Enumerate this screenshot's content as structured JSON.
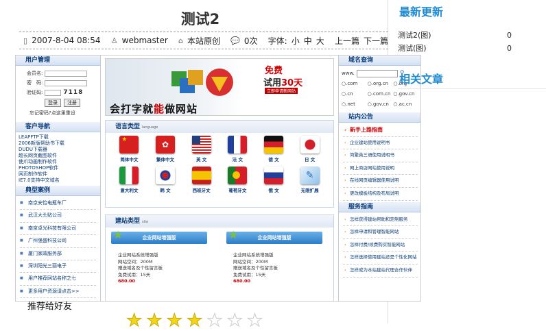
{
  "article": {
    "title": "测试2",
    "date": "2007-8-04 08:54",
    "author": "webmaster",
    "source": "本站原创",
    "views": "0次",
    "font_label": "字体:",
    "font_small": "小",
    "font_medium": "中",
    "font_large": "大",
    "prev": "上一篇",
    "next": "下一篇"
  },
  "screenshot": {
    "login": {
      "header": "用户管理",
      "user_label": "会员名:",
      "pass_label": "密　码:",
      "code_label": "验证码:",
      "code_value": "7118",
      "login_btn": "登录",
      "register_btn": "注册",
      "forgot": "忘记密码?点这里重设"
    },
    "client_nav": {
      "header": "客户导航",
      "items": [
        "LEAPFTP下载",
        "2006新版帮助书下载",
        "DUDU下载器",
        "超长网页截图软件",
        "使爪动画制作软件",
        "PHOTOSHOP软件",
        "网页制作软件",
        "IE7.0支持中文域名"
      ]
    },
    "cases": {
      "header": "典型案例",
      "items": [
        "南京安怡电瓶车厂",
        "武汉大头贴公司",
        "南京卓光科技有限公司",
        "广州强盛科技公司",
        "厦门家政服务部",
        "深圳阳光三丽电子",
        "用户推荐网站名称之七",
        "更多用户资源请点击>>"
      ]
    },
    "banner": {
      "line1_a": "会打字就",
      "line1_b": "能",
      "line1_c": "做网站",
      "free": "免费",
      "trial_a": "试用",
      "trial_b": "30天",
      "apply": "立即申请新网站"
    },
    "languages": {
      "header": "语言类型",
      "sub": "language",
      "items": [
        "简体中文",
        "繁体中文",
        "英 文",
        "法 文",
        "德 文",
        "日 文",
        "意大利文",
        "韩 文",
        "西班牙文",
        "葡萄牙文",
        "俄 文",
        "无限扩展"
      ]
    },
    "site_types": {
      "header": "建站类型",
      "sub": "site",
      "cards": [
        {
          "banner": "企业网站增强版",
          "l1": "企业网站系统增强版",
          "l2": "网站空间：200M",
          "l3": "赠送域名及个性留言板",
          "l4": "免费试用：15天",
          "price": "680.00"
        },
        {
          "banner": "企业网站增强版",
          "l1": "企业网站系统增强版",
          "l2": "网站空间：200M",
          "l3": "赠送域名及个性留言板",
          "l4": "免费试用：15天",
          "price": "680.00"
        }
      ]
    },
    "domain": {
      "header": "域名查询",
      "www": "www.",
      "exts": [
        ".com",
        ".org.cn",
        ".org",
        ".cn",
        ".com.cn",
        ".gov.cn",
        ".net",
        ".gov.cn",
        ".ac.cn"
      ]
    },
    "notice": {
      "header": "站内公告",
      "items": [
        "新手上路指南",
        "企业建站使用说明书",
        "简繁英三语使用说明书",
        "网上商店网站使用说明",
        "在线网页编辑器使用说明",
        "更改模板结构及布局说明"
      ]
    },
    "service": {
      "header": "服务指南",
      "items": [
        "怎样获得建站帮助和定制服务",
        "怎样申请和管理智能网站",
        "怎样付费/续费购买智能网站",
        "怎样选择使用建站还是个性化网站",
        "怎样成为本站建站代理合作伙伴"
      ]
    }
  },
  "sidebar": {
    "latest_title": "最新更新",
    "latest": [
      {
        "name": "测试2(图)",
        "count": "0"
      },
      {
        "name": "测试(图)",
        "count": "0"
      }
    ],
    "related_title": "相关文章"
  },
  "recommend": "推荐给好友",
  "rating": {
    "value": 4,
    "max": 7
  }
}
